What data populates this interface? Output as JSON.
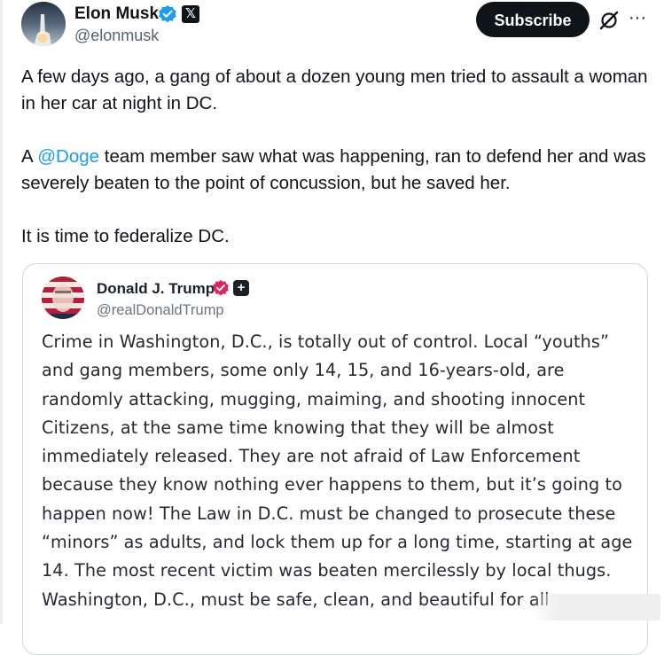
{
  "author": {
    "name": "Elon Musk",
    "handle": "@elonmusk",
    "verified": true,
    "affiliate_badge": "𝕏"
  },
  "actions": {
    "subscribe_label": "Subscribe",
    "grok_icon": "grok-icon",
    "more_icon": "more-icon",
    "more_glyph": "···"
  },
  "tweet": {
    "para1": "A few days ago, a gang of about a dozen young men tried to assault a woman in her car at night in DC.",
    "para2_prefix": "A ",
    "para2_mention": "@Doge",
    "para2_suffix": " team member saw what was happening, ran to defend her and was severely beaten to the point of concussion, but he saved her.",
    "para3": "It is time to federalize DC."
  },
  "quote": {
    "name": "Donald J. Trump",
    "handle": "@realDonaldTrump",
    "plus_badge": "+",
    "text": "Crime in Washington, D.C., is totally out of control. Local “youths” and gang members, some only 14, 15, and 16-years-old, are randomly attacking, mugging, maiming, and shooting innocent Citizens, at the same time knowing that they will be almost immediately released. They are not afraid of Law Enforcement because they know nothing ever happens to them, but it’s going to happen now! The Law in D.C. must be changed to prosecute these “minors” as adults, and lock them up for a long time, starting at age 14. The most recent victim was beaten mercilessly by local thugs. Washington, D.C., must be safe, clean, and beautiful for all"
  },
  "colors": {
    "mention": "#1d9bf0",
    "verified_blue": "#1d9bf0",
    "quote_verified_pink": "#e0245e",
    "subscribe_bg": "#0f1419"
  }
}
